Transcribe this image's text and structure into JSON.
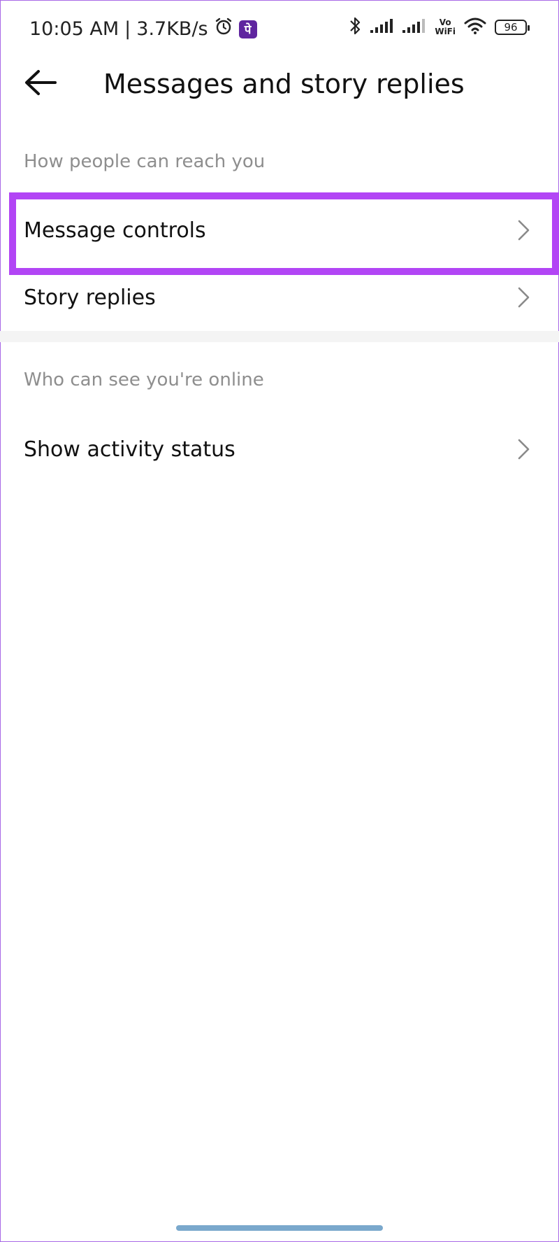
{
  "status_bar": {
    "time": "10:05 AM",
    "separator": "|",
    "speed": "3.7KB/s",
    "app_badge": "पे",
    "vowifi_top": "Vo",
    "vowifi_bottom": "WiFi",
    "battery": "96"
  },
  "header": {
    "back_icon": "arrow-left-icon",
    "title": "Messages and story replies"
  },
  "sections": [
    {
      "label": "How people can reach you",
      "items": [
        {
          "label": "Message controls",
          "highlighted": true
        },
        {
          "label": "Story replies",
          "highlighted": false
        }
      ]
    },
    {
      "label": "Who can see you're online",
      "items": [
        {
          "label": "Show activity status",
          "highlighted": false
        }
      ]
    }
  ],
  "colors": {
    "highlight": "#b245f5",
    "section_label": "#8e8e8e",
    "divider": "#f4f4f4",
    "home_indicator": "#7aa8cc",
    "frame": "#a868e6"
  }
}
